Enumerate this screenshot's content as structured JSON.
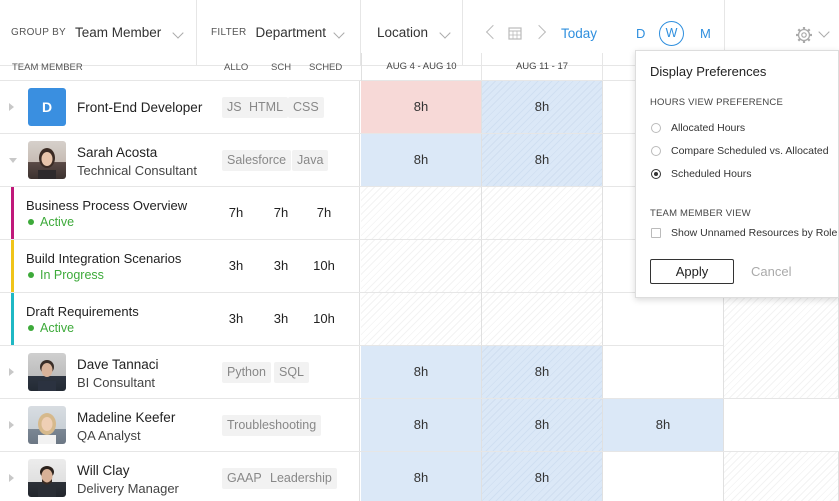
{
  "toolbar": {
    "group_by_label": "GROUP BY",
    "group_by_value": "Team Member",
    "filter_label": "FILTER",
    "filter_value": "Department",
    "location_value": "Location",
    "today": "Today",
    "view_d": "D",
    "view_w": "W",
    "view_m": "M"
  },
  "columns": {
    "team_member": "TEAM MEMBER",
    "allo": "ALLO",
    "sch": "SCH",
    "sched": "SCHED",
    "weeks": [
      "AUG 4 - AUG 10",
      "AUG 11 - 17"
    ]
  },
  "rows": [
    {
      "type": "role",
      "initial": "D",
      "name": "Front-End Developer",
      "tags": [
        "JS",
        "HTML",
        "CSS"
      ],
      "cells": [
        "8h",
        "8h"
      ]
    },
    {
      "type": "person",
      "name": "Sarah Acosta",
      "role": "Technical Consultant",
      "tags": [
        "Salesforce",
        "Java"
      ],
      "cells": [
        "8h",
        "8h"
      ]
    },
    {
      "type": "task",
      "name": "Business Process Overview",
      "status": "Active",
      "allo": "7h",
      "sch": "7h",
      "sched": "7h",
      "color": "#c0187a"
    },
    {
      "type": "task",
      "name": "Build Integration Scenarios",
      "status": "In Progress",
      "allo": "3h",
      "sch": "3h",
      "sched": "10h",
      "color": "#f0c419"
    },
    {
      "type": "task",
      "name": "Draft Requirements",
      "status": "Active",
      "allo": "3h",
      "sch": "3h",
      "sched": "10h",
      "color": "#1fb8c4"
    },
    {
      "type": "person",
      "name": "Dave Tannaci",
      "role": "BI Consultant",
      "tags": [
        "Python",
        "SQL"
      ],
      "cells": [
        "8h",
        "8h"
      ]
    },
    {
      "type": "person",
      "name": "Madeline Keefer",
      "role": "QA Analyst",
      "tags": [
        "Troubleshooting"
      ],
      "cells": [
        "8h",
        "8h",
        "8h"
      ]
    },
    {
      "type": "person",
      "name": "Will Clay",
      "role": "Delivery Manager",
      "tags": [
        "GAAP",
        "Leadership"
      ],
      "cells": [
        "8h",
        "8h"
      ]
    }
  ],
  "popover": {
    "title": "Display Preferences",
    "hours_section": "HOURS VIEW PREFERENCE",
    "options": [
      "Allocated Hours",
      "Compare Scheduled vs. Allocated",
      "Scheduled Hours"
    ],
    "member_section": "TEAM MEMBER VIEW",
    "checkbox_label": "Show Unnamed Resources by Role",
    "apply": "Apply",
    "cancel": "Cancel"
  },
  "colors": {
    "accent": "#2f8fde",
    "allocated_blue": "#dbe8f7",
    "overallocated_pink": "#f7d9d7",
    "status_green": "#3daa3a"
  }
}
